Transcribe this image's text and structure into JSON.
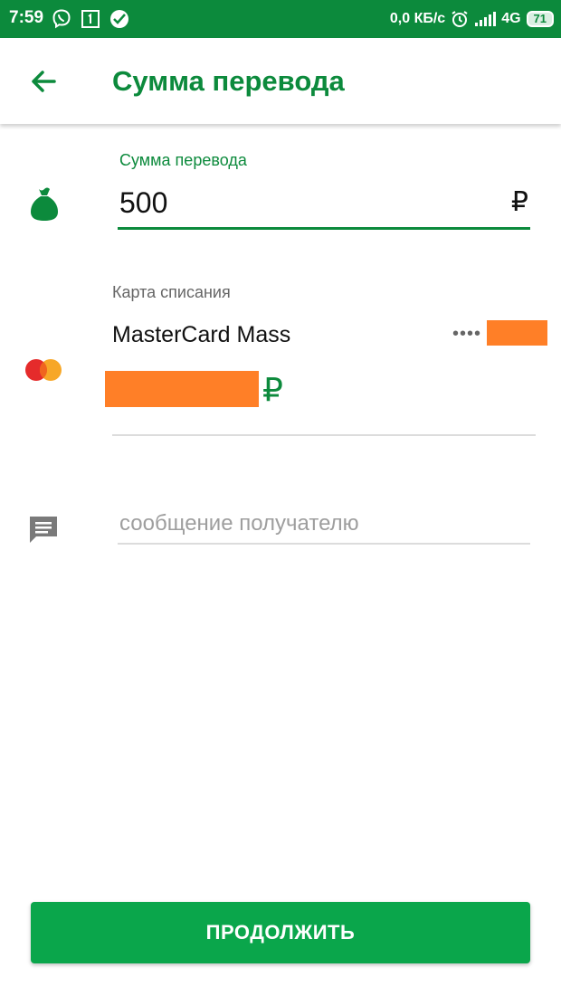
{
  "status_bar": {
    "time": "7:59",
    "network_speed": "0,0 КБ/с",
    "network_type": "4G",
    "battery": "71",
    "notification_icons": [
      "viber-icon",
      "sim-1-icon",
      "sberbank-icon"
    ],
    "background_color": "#0c8a3c"
  },
  "app_bar": {
    "title": "Сумма перевода",
    "back_icon": "arrow-back-icon"
  },
  "amount": {
    "label": "Сумма перевода",
    "value": "500",
    "currency": "₽",
    "icon": "money-bag-icon"
  },
  "card": {
    "label": "Карта списания",
    "name": "MasterCard Mass",
    "number_mask": "••••",
    "balance_currency": "₽",
    "logo": "mastercard-logo",
    "redacted": true
  },
  "message": {
    "placeholder": "сообщение получателю",
    "value": "",
    "icon": "message-icon"
  },
  "actions": {
    "continue_label": "ПРОДОЛЖИТЬ"
  },
  "colors": {
    "brand_green": "#0c8a3c",
    "button_green": "#0aa64b",
    "redaction_orange": "#ff7f27"
  }
}
